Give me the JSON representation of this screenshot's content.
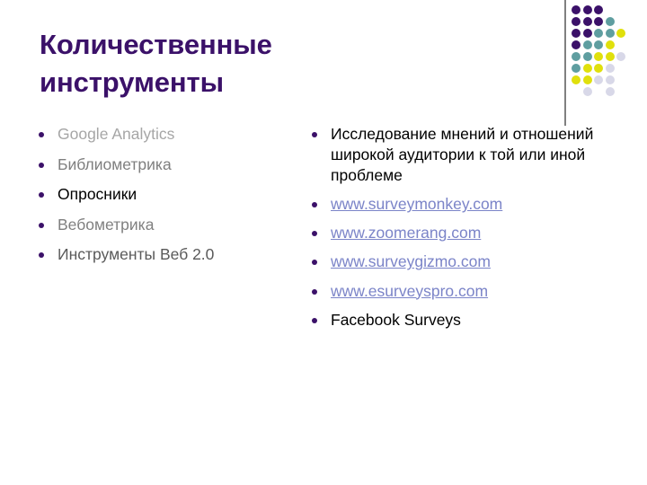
{
  "slide": {
    "title_lines": [
      "Количественные",
      "инструменты"
    ],
    "title_color": "#3b1169",
    "background": "#ffffff",
    "divider_color": "#808080"
  },
  "left_column": {
    "items": [
      {
        "text": "Google Analytics",
        "color": "#a6a6a6"
      },
      {
        "text": "Библиометрика",
        "color": "#7f7f7f"
      },
      {
        "text": "Опросники",
        "color": "#000000"
      },
      {
        "text": "Вебометрика",
        "color": "#808080"
      },
      {
        "text": "Инструменты Веб 2.0",
        "color": "#5a5a5a"
      }
    ]
  },
  "right_column": {
    "items": [
      {
        "text": "Исследование мнений и отношений широкой аудитории к той или иной проблеме",
        "type": "text",
        "color": "#000000"
      },
      {
        "text": "www.surveymonkey.com",
        "type": "link",
        "color": "#7b84c8"
      },
      {
        "text": "www.zoomerang.com",
        "type": "link",
        "color": "#7b84c8"
      },
      {
        "text": "www.surveygizmo.com",
        "type": "link",
        "color": "#7b84c8"
      },
      {
        "text": "www.esurveyspro.com",
        "type": "link",
        "color": "#7b84c8"
      },
      {
        "text": "Facebook Surveys",
        "type": "text",
        "color": "#000000"
      }
    ]
  },
  "decor": {
    "bullet_color": "#3b1169",
    "palette": {
      "purple": "#3b1169",
      "teal": "#5f9ea0",
      "yellow": "#e0e00c",
      "lavender": "#d8d8e8"
    },
    "dot_grid": {
      "rows": 8,
      "cols": 5,
      "dot_size": 10,
      "step_x": 12.5,
      "step_y": 13,
      "cells": [
        [
          "purple",
          "purple",
          "purple",
          null,
          null
        ],
        [
          "purple",
          "purple",
          "purple",
          "teal",
          null
        ],
        [
          "purple",
          "purple",
          "teal",
          "teal",
          "yellow"
        ],
        [
          "purple",
          "teal",
          "teal",
          "yellow",
          null
        ],
        [
          "teal",
          "teal",
          "yellow",
          "yellow",
          "lavender"
        ],
        [
          "teal",
          "yellow",
          "yellow",
          "lavender",
          null
        ],
        [
          "yellow",
          "yellow",
          "lavender",
          "lavender",
          null
        ],
        [
          null,
          "lavender",
          null,
          "lavender",
          null
        ]
      ]
    }
  }
}
